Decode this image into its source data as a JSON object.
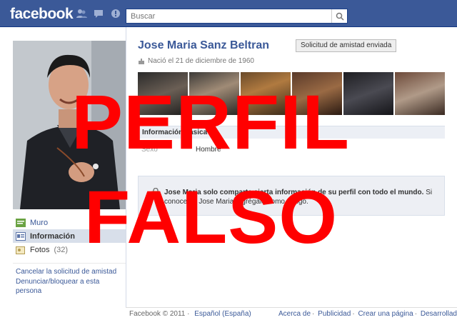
{
  "topbar": {
    "logo": "facebook",
    "icons": [
      "friends-icon",
      "messages-icon",
      "notifications-icon"
    ],
    "search_placeholder": "Buscar"
  },
  "profile": {
    "name": "Jose Maria Sanz Beltran",
    "friend_request_label": "Solicitud de amistad enviada",
    "born": "Nació el 21 de diciembre de 1960"
  },
  "sidebar": {
    "items": [
      {
        "label": "Muro",
        "count": ""
      },
      {
        "label": "Información",
        "count": ""
      },
      {
        "label": "Fotos",
        "count": "(32)"
      }
    ],
    "links": [
      "Cancelar la solicitud de amistad",
      "Denunciar/bloquear a esta persona"
    ]
  },
  "info": {
    "section_title": "Información básica",
    "sex_label": "Sexo",
    "sex_value": "Hombre"
  },
  "privacy": {
    "bold_text": "Jose Maria solo comparte cierta información de su perfil con todo el mundo.",
    "text": "Si conoces a Jose Maria, agrégalo como amigo."
  },
  "footer": {
    "copyright": "Facebook © 2011 ·",
    "language": "Español (España)",
    "links": [
      "Acerca de",
      "Publicidad",
      "Crear una página",
      "Desarrolladores"
    ]
  },
  "overlay": {
    "line1": "PERFIL",
    "line2": "FALSO"
  },
  "colors": {
    "brand": "#3b5998",
    "stamp": "#ff0000"
  }
}
